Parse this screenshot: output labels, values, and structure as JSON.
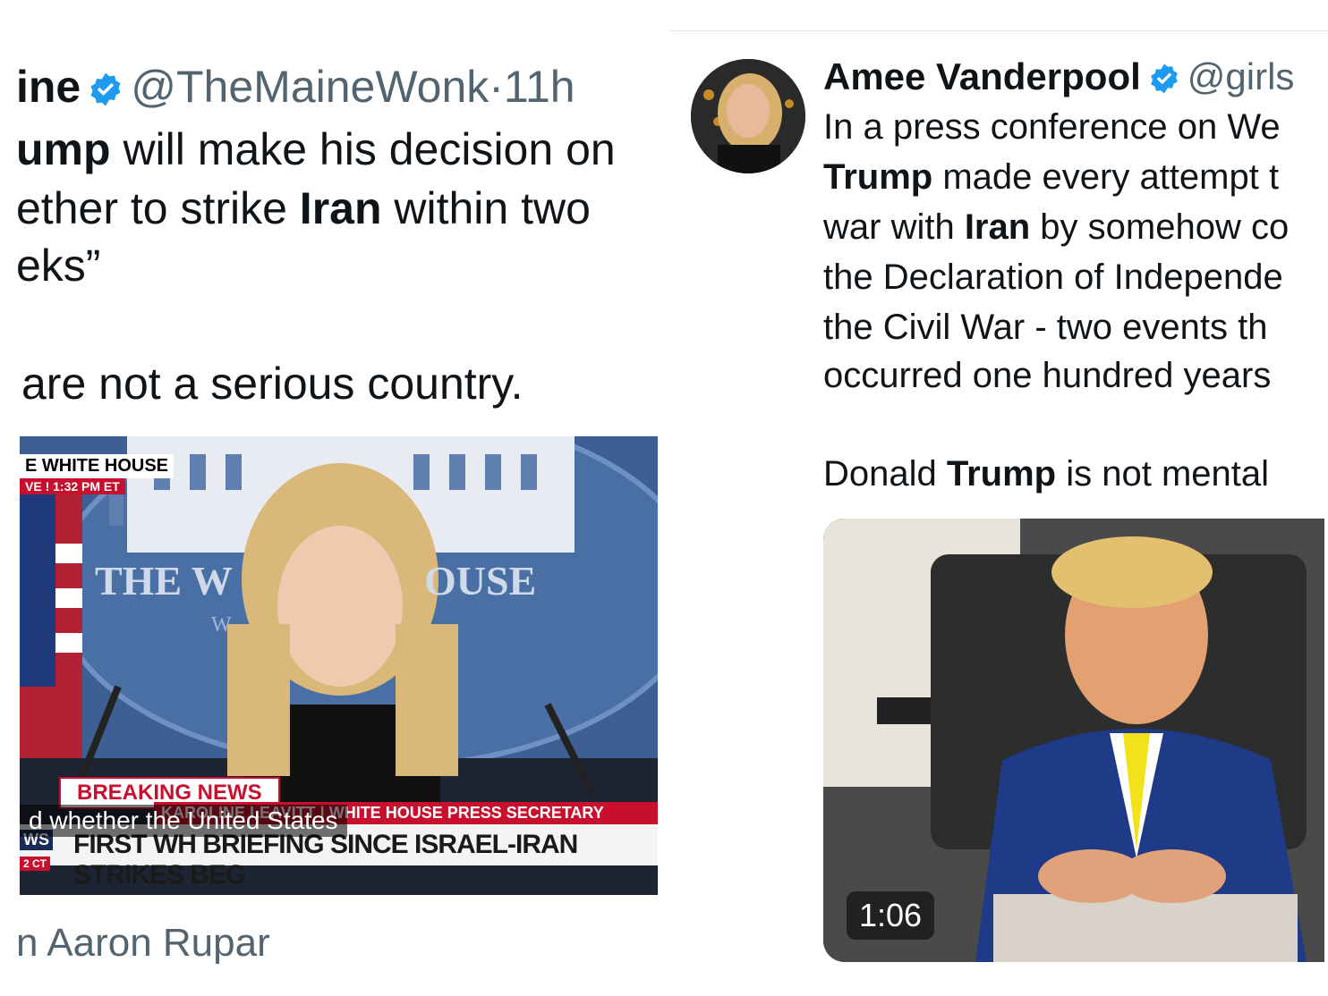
{
  "left_tweet": {
    "author_partial": "ine",
    "handle": "@TheMaineWonk",
    "dot": "·",
    "time": "11h",
    "line1_bold": "ump",
    "line1_rest": " will make his decision on",
    "line2_pre": "ether to strike ",
    "line2_bold": "Iran",
    "line2_post": " within two",
    "line3": "eks”",
    "line4": "are not a serious country.",
    "credit": "n Aaron Rupar",
    "video": {
      "corner_label": "E WHITE HOUSE",
      "live_label": "VE ! 1:32 PM ET",
      "wall_text_left": "THE W",
      "wall_text_right": "OUSE",
      "wall_small": "W",
      "breaking": "BREAKING NEWS",
      "subtitle_name": "KAROLINE LEAVITT | WHITE HOUSE PRESS SECRETARY",
      "caption": "d whether the United States",
      "ticker": "FIRST WH BRIEFING SINCE ISRAEL-IRAN STRIKES BEG",
      "network_tag": "WS",
      "time_tag": "2 CT"
    }
  },
  "right_tweet": {
    "name": "Amee Vanderpool",
    "handle": "@girls",
    "line1": "In a press conference on We",
    "line2_bold": "Trump",
    "line2_rest": " made every attempt t",
    "line3_pre": "war with ",
    "line3_bold": "Iran",
    "line3_post": " by somehow co",
    "line4": "the Declaration of Independe",
    "line5": "the Civil War - two events th",
    "line6": "occurred one hundred years",
    "line7_pre": "Donald ",
    "line7_bold": "Trump",
    "line7_post": " is not mental",
    "video_duration": "1:06"
  },
  "colors": {
    "verified": "#1d9bf0",
    "muted": "#536471",
    "breaking_red": "#c8102e"
  }
}
